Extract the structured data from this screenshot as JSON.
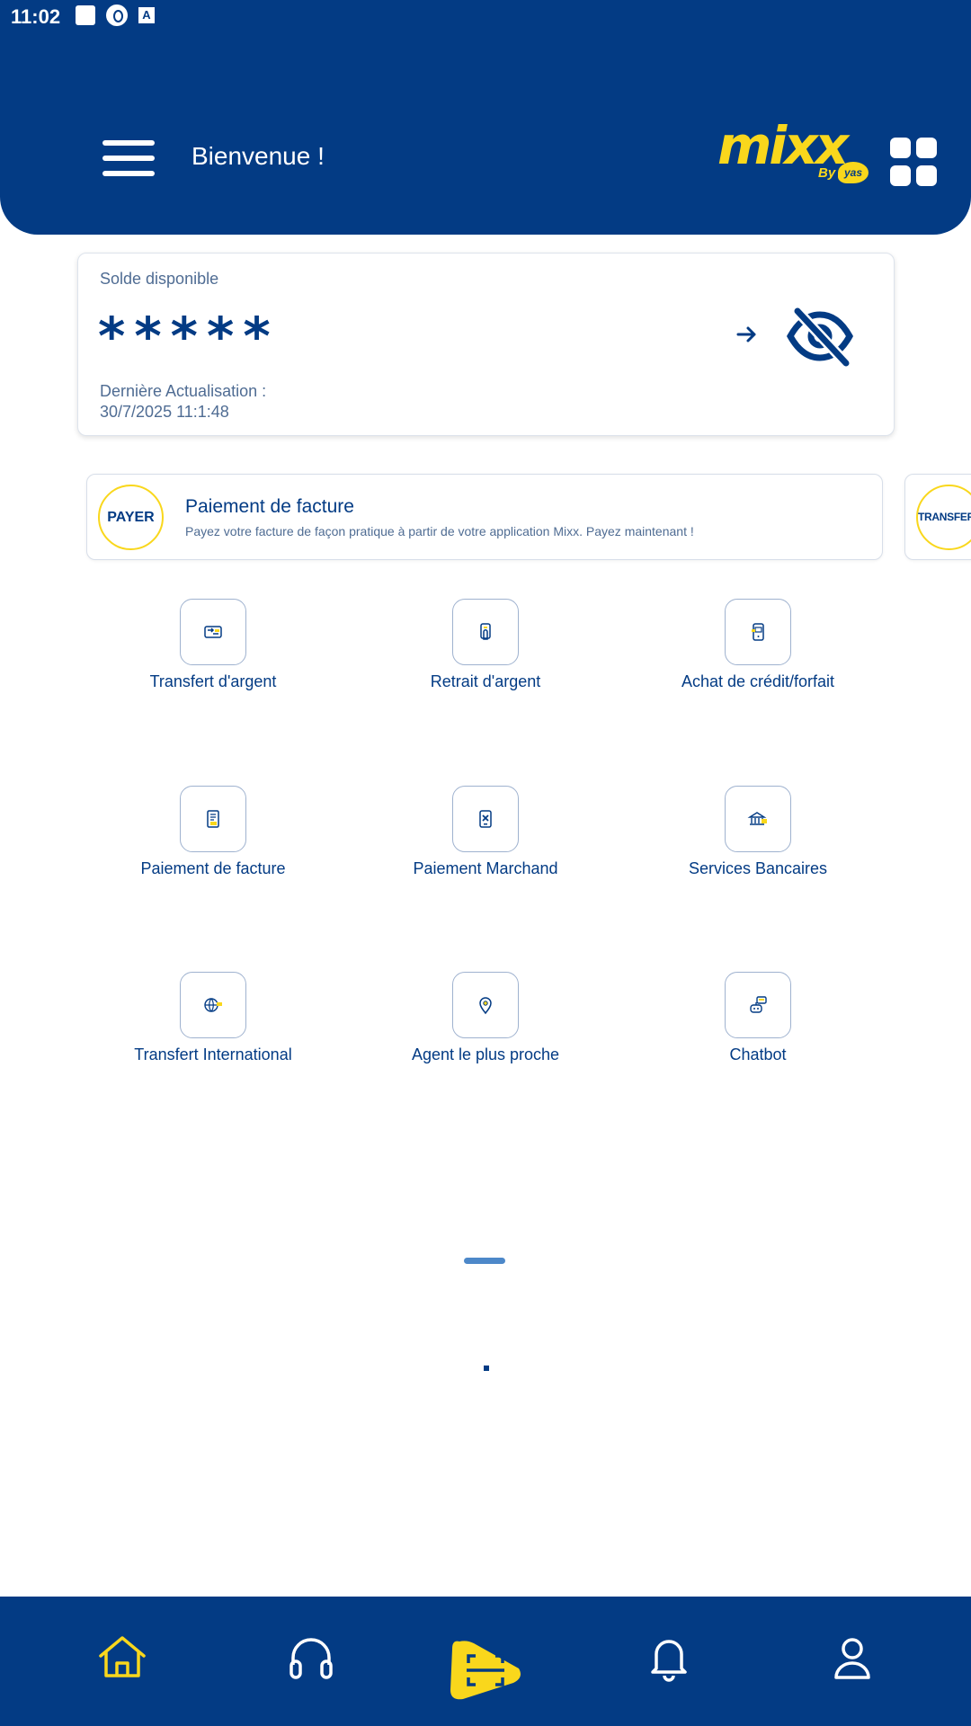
{
  "status_bar": {
    "time": "11:02"
  },
  "header": {
    "welcome": "Bienvenue !",
    "logo_text": "mixx",
    "logo_by": "By",
    "logo_brand": "yas"
  },
  "balance": {
    "label": "Solde disponible",
    "value": "*****",
    "update_label": "Dernière Actualisation :",
    "update_time": "30/7/2025 11:1:48"
  },
  "promos": [
    {
      "badge": "PAYER",
      "title": "Paiement de facture",
      "subtitle": "Payez votre facture de façon pratique à partir de votre application Mixx. Payez maintenant !"
    },
    {
      "badge": "TRANSFERT"
    }
  ],
  "services": [
    {
      "label": "Transfert d'argent",
      "icon": "money-transfer-icon"
    },
    {
      "label": "Retrait d'argent",
      "icon": "cash-withdrawal-icon"
    },
    {
      "label": "Achat de crédit/forfait",
      "icon": "airtime-purchase-icon"
    },
    {
      "label": "Paiement de facture",
      "icon": "bill-payment-icon"
    },
    {
      "label": "Paiement Marchand",
      "icon": "merchant-payment-icon"
    },
    {
      "label": "Services Bancaires",
      "icon": "bank-services-icon"
    },
    {
      "label": "Transfert International",
      "icon": "international-transfer-icon"
    },
    {
      "label": "Agent le plus proche",
      "icon": "location-pin-icon"
    },
    {
      "label": "Chatbot",
      "icon": "chatbot-icon"
    }
  ],
  "bottom_nav": [
    "home-icon",
    "headset-icon",
    "scan-icon",
    "bell-icon",
    "user-icon"
  ],
  "colors": {
    "brand_blue": "#033B84",
    "accent_yellow": "#F9D71C",
    "text_muted": "#4F6C93"
  }
}
